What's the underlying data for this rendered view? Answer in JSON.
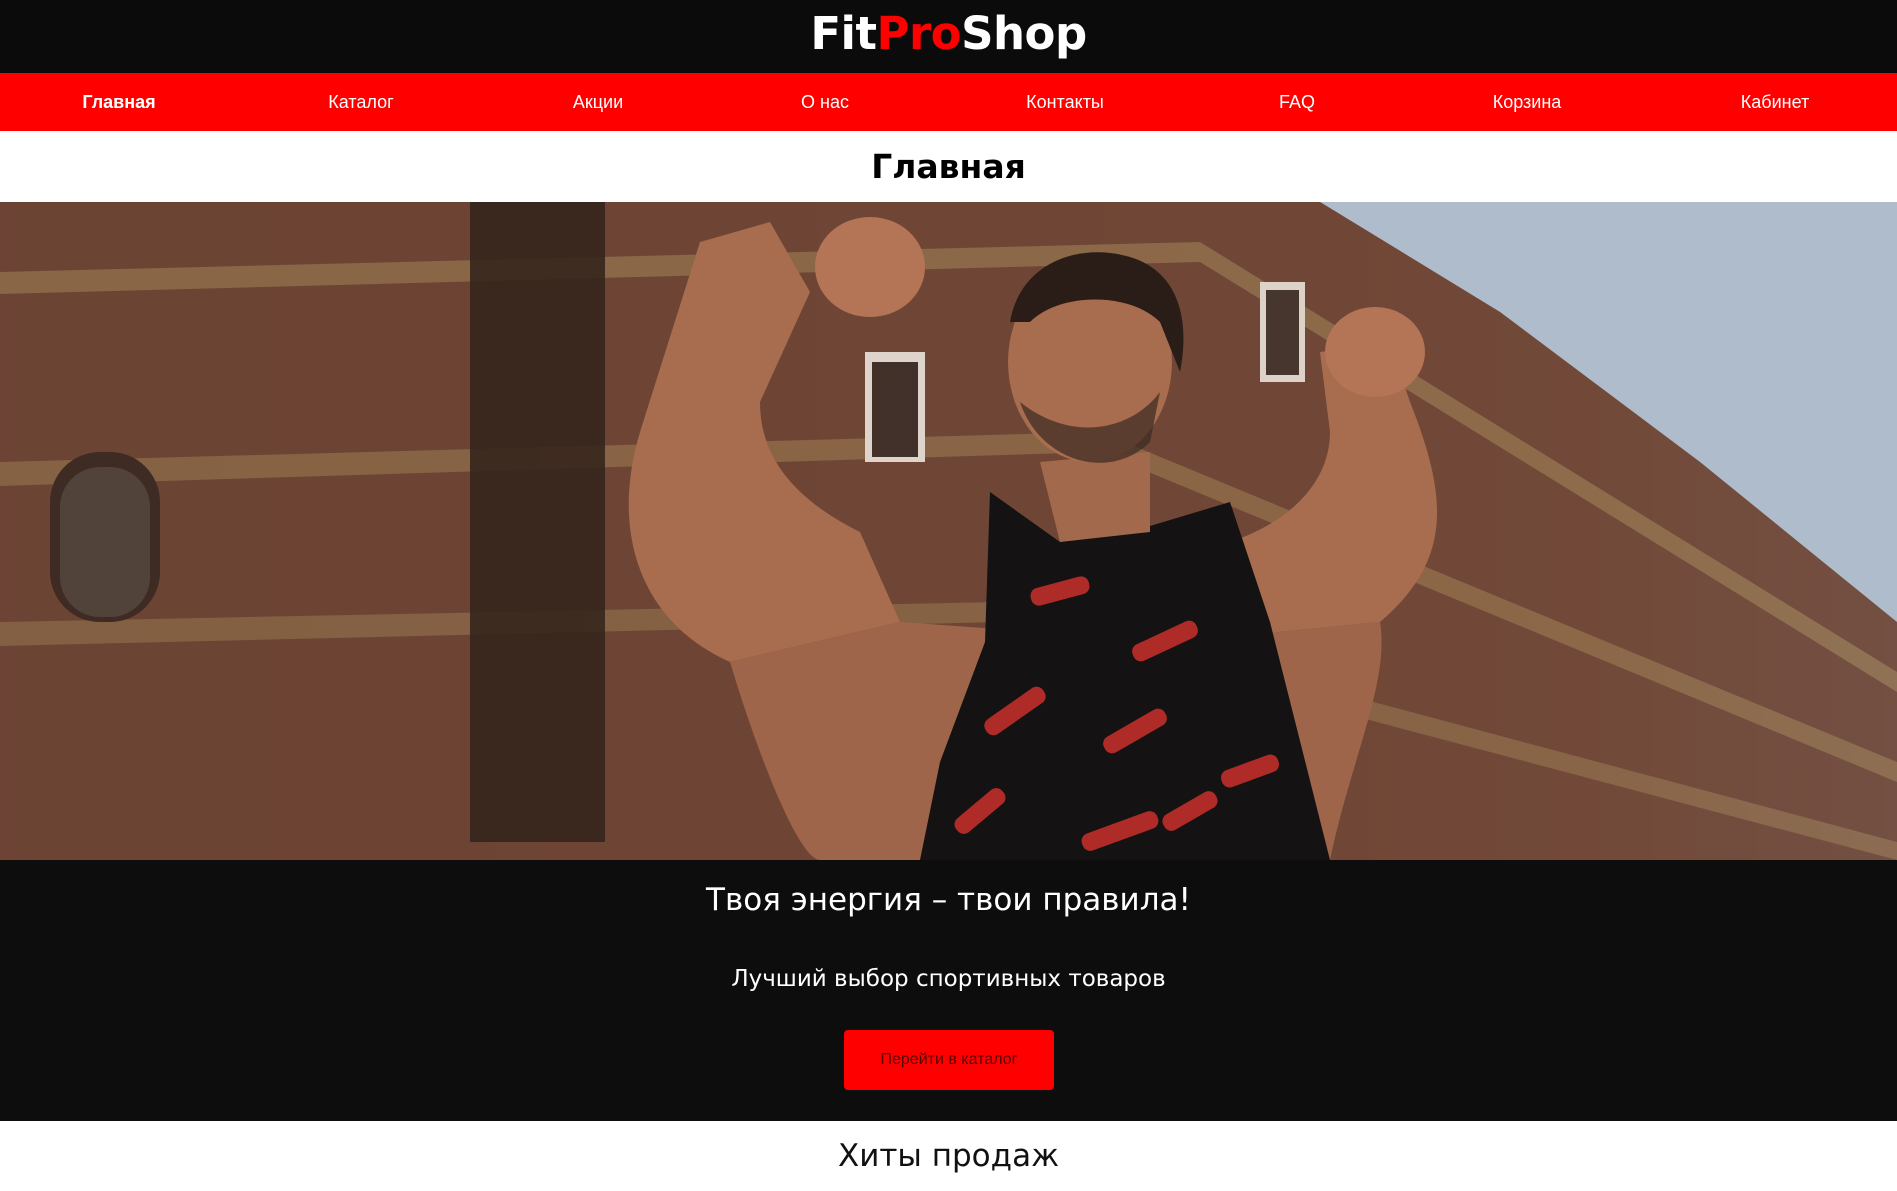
{
  "brand": {
    "part1": "Fit",
    "part2": "Pro",
    "part3": "Shop",
    "accent_color": "#ff0000",
    "bar_color": "#0b0b0b"
  },
  "nav": {
    "items": [
      {
        "label": "Главная",
        "active": true
      },
      {
        "label": "Каталог",
        "active": false
      },
      {
        "label": "Акции",
        "active": false
      },
      {
        "label": "О нас",
        "active": false
      },
      {
        "label": "Контакты",
        "active": false
      },
      {
        "label": "FAQ",
        "active": false
      },
      {
        "label": "Корзина",
        "active": false
      },
      {
        "label": "Кабинет",
        "active": false
      }
    ]
  },
  "page": {
    "title": "Главная"
  },
  "promo": {
    "title": "Твоя энергия – твои правила!",
    "subtitle": "Лучший выбор спортивных товаров",
    "button_label": "Перейти в каталог"
  },
  "hits": {
    "title": "Хиты продаж"
  }
}
